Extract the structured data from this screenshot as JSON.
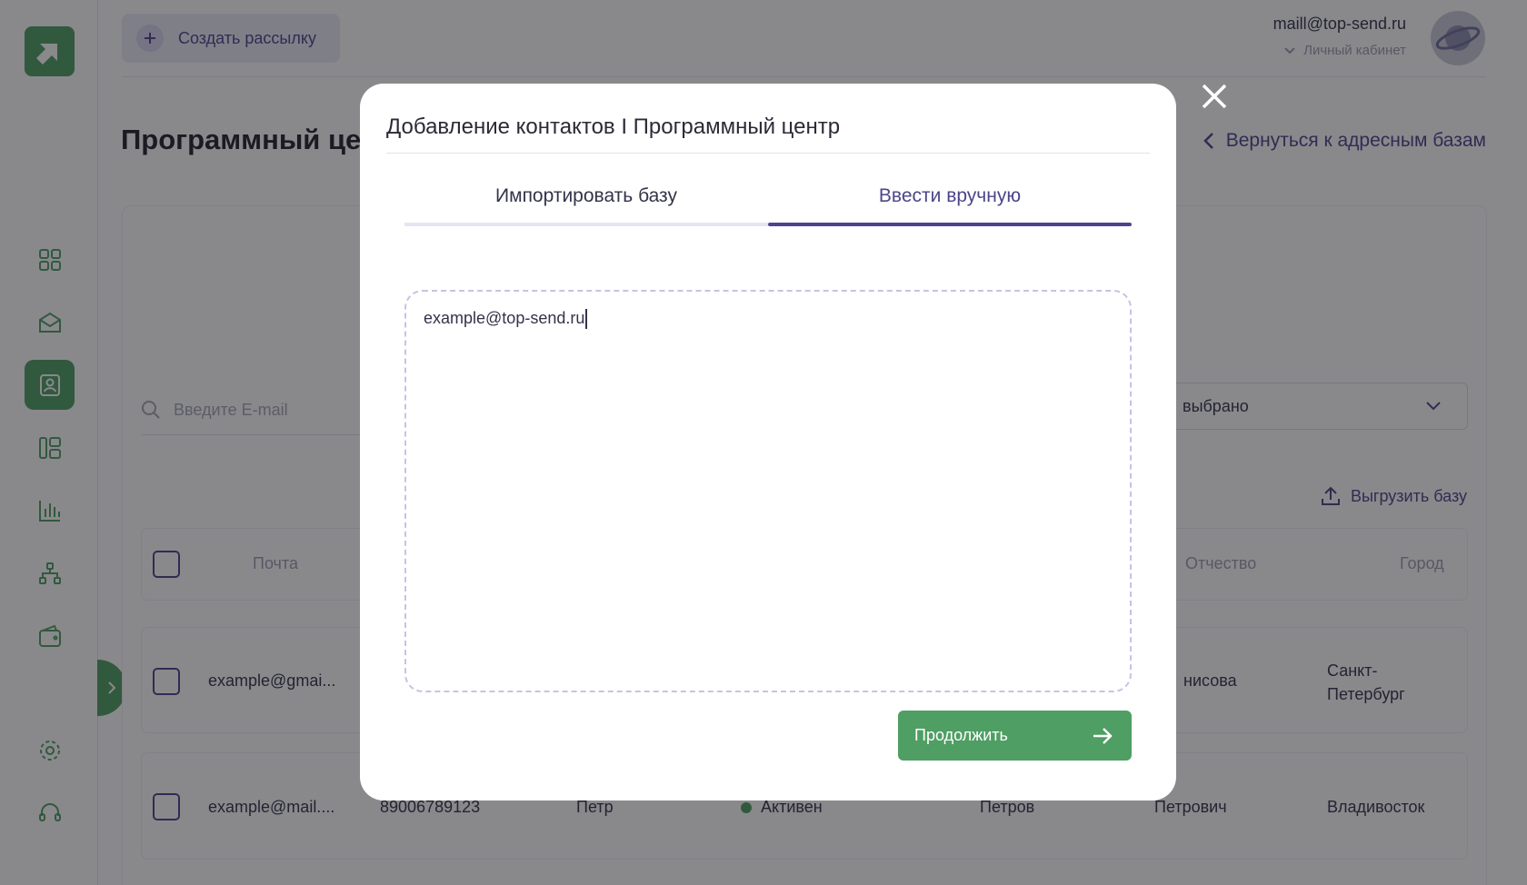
{
  "header": {
    "create_label": "Создать рассылку",
    "user_email": "maill@top-send.ru",
    "cabinet_label": "Личный кабинет"
  },
  "page": {
    "title": "Программный це",
    "back_label": "Вернуться к адресным базам"
  },
  "search": {
    "placeholder": "Введите E-mail"
  },
  "filter": {
    "value": "выбрано"
  },
  "export_label": "Выгрузить базу",
  "table": {
    "headers": {
      "email": "Почта",
      "patronymic": "Отчество",
      "city": "Город"
    },
    "rows": [
      {
        "email": "example@gmai...",
        "surname": "нисова",
        "city": "Санкт-Петербург"
      },
      {
        "email": "example@mail....",
        "phone": "89006789123",
        "name": "Петр",
        "status": "Активен",
        "surname": "Петров",
        "patronymic": "Петрович",
        "city": "Владивосток"
      }
    ]
  },
  "modal": {
    "title": "Добавление контактов I Программный центр",
    "tabs": [
      {
        "label": "Импортировать базу",
        "active": false
      },
      {
        "label": "Ввести вручную",
        "active": true
      }
    ],
    "textarea_value": "example@top-send.ru",
    "continue_label": "Продолжить"
  },
  "colors": {
    "accent": "#4c458a",
    "green": "#4f9e63"
  }
}
